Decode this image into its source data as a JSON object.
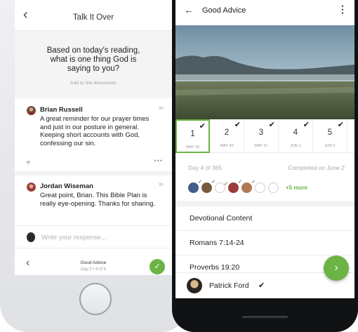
{
  "colors": {
    "accent": "#6ab344"
  },
  "iphone": {
    "title": "Talk It Over",
    "back_icon": "chevron-left-icon",
    "question": "Based on today's reading, what is one thing God is saying to you?",
    "add_link": "Add to the discussion",
    "comments": [
      {
        "name": "Brian Russell",
        "time": "3h",
        "text": "A great reminder for our prayer times and just in our posture in general. Keeping short accounts with God, confessing our sin."
      },
      {
        "name": "Jordan Wiseman",
        "time": "3h",
        "text": "Great point, Brian. This Bible Plan is really eye-opening. Thanks for sharing."
      }
    ],
    "response_placeholder": "Write your response...",
    "footer": {
      "plan": "Good Advice",
      "progress": "Day 2 • 4 of 4"
    }
  },
  "android": {
    "title": "Good Advice",
    "days": [
      {
        "num": "1",
        "date": "MAY 29",
        "done": true,
        "selected": true
      },
      {
        "num": "2",
        "date": "MAY 30",
        "done": true,
        "selected": false
      },
      {
        "num": "3",
        "date": "MAY 31",
        "done": true,
        "selected": false
      },
      {
        "num": "4",
        "date": "JUN 1",
        "done": true,
        "selected": false
      },
      {
        "num": "5",
        "date": "JUN 2",
        "done": true,
        "selected": false
      }
    ],
    "day_progress": "Day 4 of 365",
    "completed": "Completed on June 2",
    "more_friends": "+5 more",
    "content_items": [
      "Devotional Content",
      "Romans 7:14-24",
      "Proverbs 19:20"
    ],
    "user": {
      "name": "Patrick Ford",
      "check": "✔"
    }
  }
}
